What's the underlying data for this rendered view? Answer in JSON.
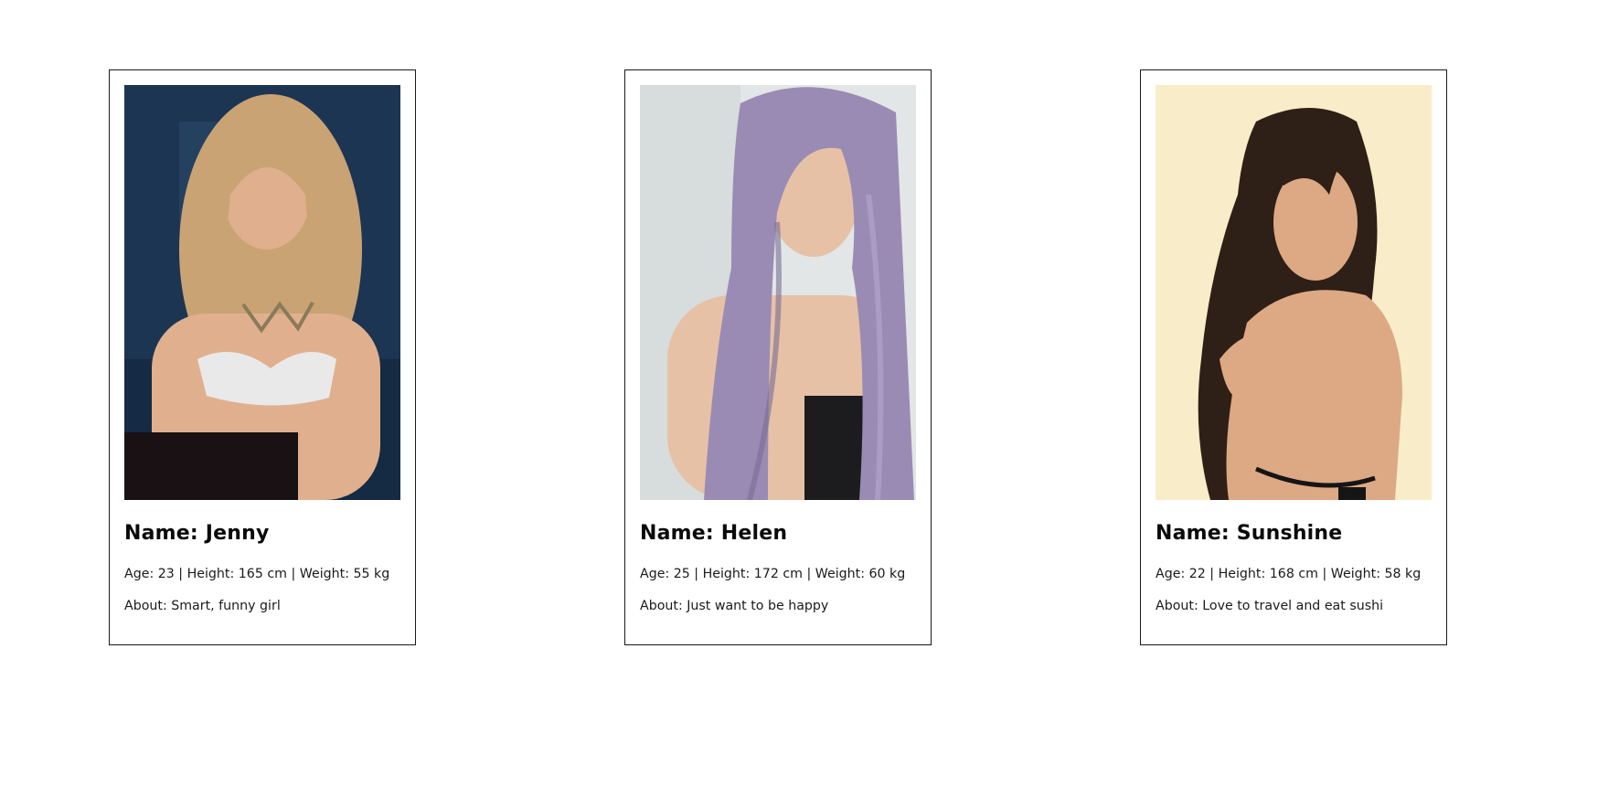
{
  "profiles": [
    {
      "name_line": "Name: Jenny",
      "stats_line": "Age: 23 | Height: 165 cm | Weight: 55 kg",
      "about_line": "About: Smart, funny girl",
      "photo": {
        "background": "#1b3552",
        "hair": "#c9a374",
        "skin": "#e0b08e",
        "top": "#e9e9ea",
        "bottom": "#1a1114"
      }
    },
    {
      "name_line": "Name: Helen",
      "stats_line": "Age: 25 | Height: 172 cm | Weight: 60 kg",
      "about_line": "About: Just want to be happy",
      "photo": {
        "background": "#e2e6e6",
        "hair": "#9a8bb4",
        "skin": "#e7c1a5",
        "top": "#1c1c1e",
        "bottom": "#1c1c1e"
      }
    },
    {
      "name_line": "Name: Sunshine",
      "stats_line": "Age: 22 | Height: 168 cm | Weight: 58 kg",
      "about_line": "About: Love to travel and eat sushi",
      "photo": {
        "background": "#f8edc8",
        "hair": "#2e1f17",
        "skin": "#dca984",
        "top": "#151515",
        "bottom": "#151515"
      }
    }
  ]
}
